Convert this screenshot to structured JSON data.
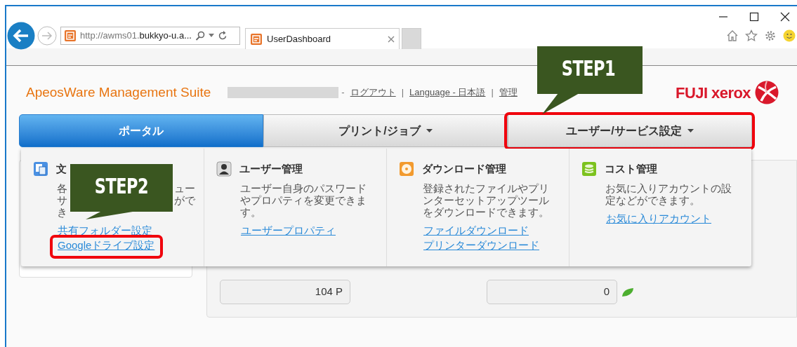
{
  "browser": {
    "address_prefix": "http://awms01.",
    "address_host": "bukkyo-u.a...",
    "tabs": [
      {
        "label": "UserDashboard",
        "selected": true
      }
    ]
  },
  "header": {
    "title": "ApeosWare Management Suite",
    "logo": "FUJI xerox",
    "items": [
      {
        "kind": "sep",
        "text": "-"
      },
      {
        "kind": "link",
        "text": "ログアウト"
      },
      {
        "kind": "sep",
        "text": "|"
      },
      {
        "kind": "link",
        "text": "Language - 日本語"
      },
      {
        "kind": "sep",
        "text": "|"
      },
      {
        "kind": "link",
        "text": "管理"
      }
    ]
  },
  "nav": [
    {
      "label": "ポータル",
      "selected": true,
      "dropdown": false,
      "highlighted": false
    },
    {
      "label": "プリント/ジョブ",
      "selected": false,
      "dropdown": true,
      "highlighted": false
    },
    {
      "label": "ユーザー/サービス設定",
      "selected": false,
      "dropdown": true,
      "highlighted": true
    }
  ],
  "menu": [
    {
      "kind": "documents",
      "title": "文",
      "lines": [
        [
          "各",
          "ュー"
        ],
        [
          "サ",
          "がで"
        ],
        [
          "き"
        ]
      ],
      "links": [
        {
          "text": "共有フォルダー設定",
          "highlighted": false
        },
        {
          "text": "Googleドライブ設定",
          "highlighted": true
        }
      ]
    },
    {
      "kind": "user",
      "title": "ユーザー管理",
      "lines": [
        [
          "ユーザー自身のパスワード"
        ],
        [
          "やプロパティを変更できま"
        ],
        [
          "す。"
        ]
      ],
      "links": [
        {
          "text": "ユーザープロパティ",
          "highlighted": false
        }
      ]
    },
    {
      "kind": "download",
      "title": "ダウンロード管理",
      "lines": [
        [
          "登録されたファイルやプリ"
        ],
        [
          "ンターセットアップツール"
        ],
        [
          "をダウンロードできます。"
        ]
      ],
      "links": [
        {
          "text": "ファイルダウンロード",
          "highlighted": false
        },
        {
          "text": "プリンターダウンロード",
          "highlighted": false
        }
      ]
    },
    {
      "kind": "cost",
      "title": "コスト管理",
      "lines": [
        [
          "お気に入りアカウントの設"
        ],
        [
          "定などができます。"
        ]
      ],
      "links": [
        {
          "text": "お気に入りアカウント",
          "highlighted": false
        }
      ]
    }
  ],
  "balances": [
    {
      "value": "104 P",
      "leaf": false
    },
    {
      "value": "0",
      "leaf": true
    }
  ],
  "annotations": [
    {
      "label": "STEP1"
    },
    {
      "label": "STEP2"
    }
  ]
}
